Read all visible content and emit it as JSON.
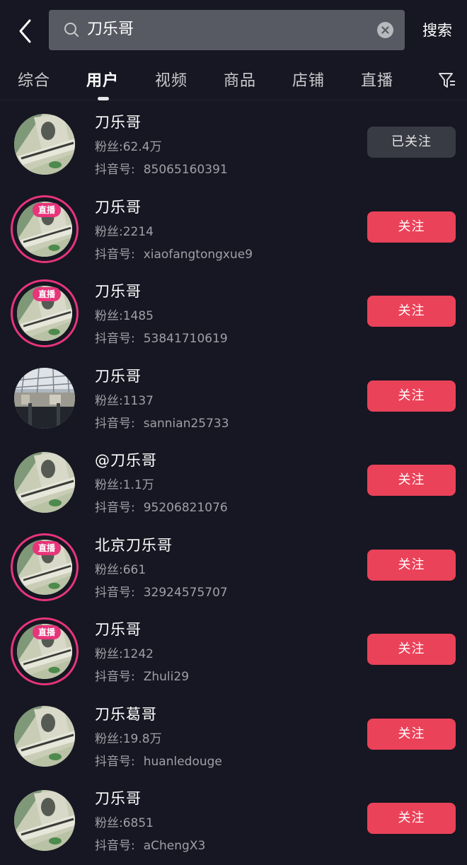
{
  "header": {
    "back_icon": "chevron-left-icon",
    "search": {
      "icon": "search-icon",
      "value": "刀乐哥",
      "clear_icon": "clear-icon"
    },
    "search_button": "搜索"
  },
  "tabs": {
    "items": [
      {
        "label": "综合",
        "active": false
      },
      {
        "label": "用户",
        "active": true
      },
      {
        "label": "视频",
        "active": false
      },
      {
        "label": "商品",
        "active": false
      },
      {
        "label": "店铺",
        "active": false
      },
      {
        "label": "直播",
        "active": false
      }
    ],
    "filter_icon": "filter-icon"
  },
  "labels": {
    "fans_prefix": "粉丝:",
    "uid_prefix": "抖音号:",
    "live_badge": "直播",
    "follow": "关注",
    "followed": "已关注"
  },
  "colors": {
    "background": "#161722",
    "follow_button": "#ea4259",
    "followed_button": "#393b44",
    "live_ring": "#e8347a"
  },
  "users": [
    {
      "name": "刀乐哥",
      "fans": "62.4万",
      "uid": "85065160391",
      "live": false,
      "followed": true,
      "avatar": "dollar"
    },
    {
      "name": "刀乐哥",
      "fans": "2214",
      "uid": "xiaofangtongxue9",
      "live": true,
      "followed": false,
      "avatar": "dollar"
    },
    {
      "name": "刀乐哥",
      "fans": "1485",
      "uid": "53841710619",
      "live": true,
      "followed": false,
      "avatar": "dollar"
    },
    {
      "name": "刀乐哥",
      "fans": "1137",
      "uid": "sannian25733",
      "live": false,
      "followed": false,
      "avatar": "building"
    },
    {
      "name": "@刀乐哥",
      "fans": "1.1万",
      "uid": "95206821076",
      "live": false,
      "followed": false,
      "avatar": "dollar"
    },
    {
      "name": "北京刀乐哥",
      "fans": "661",
      "uid": "32924575707",
      "live": true,
      "followed": false,
      "avatar": "dollar"
    },
    {
      "name": "刀乐哥",
      "fans": "1242",
      "uid": "Zhuli29",
      "live": true,
      "followed": false,
      "avatar": "dollar"
    },
    {
      "name": "刀乐葛哥",
      "fans": "19.8万",
      "uid": "huanledouge",
      "live": false,
      "followed": false,
      "avatar": "dollar"
    },
    {
      "name": "刀乐哥",
      "fans": "6851",
      "uid": "aChengX3",
      "live": false,
      "followed": false,
      "avatar": "dollar"
    }
  ]
}
